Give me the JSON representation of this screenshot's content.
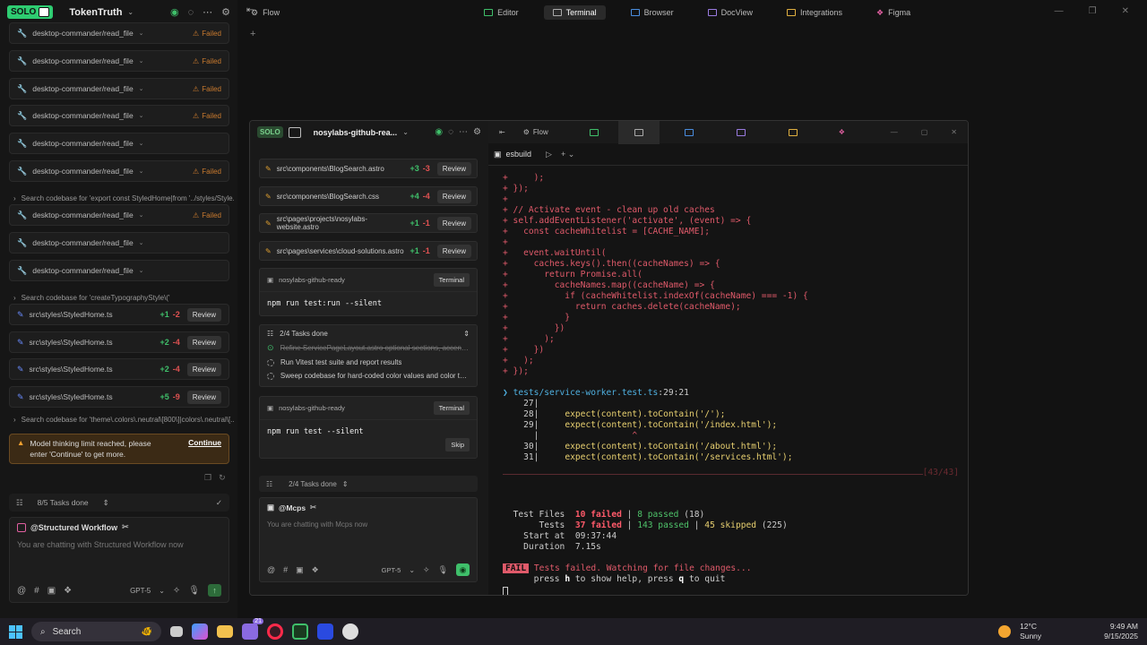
{
  "app": {
    "logo": "SOLO",
    "project": "TokenTruth"
  },
  "left": {
    "items": [
      {
        "kind": "file",
        "label": "desktop-commander/read_file",
        "status": "Failed"
      },
      {
        "kind": "file",
        "label": "desktop-commander/read_file",
        "status": "Failed"
      },
      {
        "kind": "file",
        "label": "desktop-commander/read_file",
        "status": "Failed"
      },
      {
        "kind": "file",
        "label": "desktop-commander/read_file",
        "status": "Failed"
      },
      {
        "kind": "file",
        "label": "desktop-commander/read_file",
        "status": ""
      },
      {
        "kind": "file",
        "label": "desktop-commander/read_file",
        "status": "Failed"
      },
      {
        "kind": "search",
        "label": "Search codebase for 'export const StyledHome|from '../styles/Style...'"
      },
      {
        "kind": "file",
        "label": "desktop-commander/read_file",
        "status": "Failed"
      },
      {
        "kind": "file",
        "label": "desktop-commander/read_file",
        "status": ""
      },
      {
        "kind": "file",
        "label": "desktop-commander/read_file",
        "status": ""
      },
      {
        "kind": "search",
        "label": "Search codebase for 'createTypographyStyle\\('"
      },
      {
        "kind": "diff",
        "label": "src\\styles\\StyledHome.ts",
        "plus": "+1",
        "minus": "-2",
        "btn": "Review"
      },
      {
        "kind": "diff",
        "label": "src\\styles\\StyledHome.ts",
        "plus": "+2",
        "minus": "-4",
        "btn": "Review"
      },
      {
        "kind": "diff",
        "label": "src\\styles\\StyledHome.ts",
        "plus": "+2",
        "minus": "-4",
        "btn": "Review"
      },
      {
        "kind": "diff",
        "label": "src\\styles\\StyledHome.ts",
        "plus": "+5",
        "minus": "-9",
        "btn": "Review"
      },
      {
        "kind": "search",
        "label": "Search codebase for 'theme\\.colors\\.neutral\\[800\\]|colors\\.neutral\\[..."
      }
    ],
    "warning": {
      "text": "Model thinking limit reached, please enter 'Continue' to get more.",
      "action": "Continue"
    },
    "tasks": "8/5 Tasks done",
    "chat": {
      "agent": "@Structured Workflow",
      "placeholder": "You are chatting with Structured Workflow now",
      "model": "GPT-5"
    }
  },
  "tabs": [
    {
      "label": "Flow",
      "color": "#cccccc"
    },
    {
      "label": "Editor",
      "color": "#3fbf6a"
    },
    {
      "label": "Terminal",
      "color": "#aaaaaa",
      "active": true
    },
    {
      "label": "Browser",
      "color": "#4a8ee0"
    },
    {
      "label": "DocView",
      "color": "#9a7be0"
    },
    {
      "label": "Integrations",
      "color": "#e0b040"
    },
    {
      "label": "Figma",
      "color": "#e05fa0"
    }
  ],
  "win": {
    "logo": "SOLO",
    "project": "nosylabs-github-rea...",
    "files": [
      {
        "label": "src\\components\\BlogSearch.astro",
        "plus": "+3",
        "minus": "-3",
        "btn": "Review"
      },
      {
        "label": "src\\components\\BlogSearch.css",
        "plus": "+4",
        "minus": "-4",
        "btn": "Review"
      },
      {
        "label": "src\\pages\\projects\\nosylabs-website.astro",
        "plus": "+1",
        "minus": "-1",
        "btn": "Review"
      },
      {
        "label": "src\\pages\\services\\cloud-solutions.astro",
        "plus": "+1",
        "minus": "-1",
        "btn": "Review"
      }
    ],
    "term1": {
      "name": "nosylabs-github-ready",
      "btn": "Terminal",
      "cmd": "npm run test:run --silent"
    },
    "taskpanel": {
      "title": "2/4 Tasks done",
      "items": [
        {
          "text": "Refine ServicePageLayout.astro optional sections, accent/th...",
          "done": true
        },
        {
          "text": "Run Vitest test suite and report results",
          "done": false
        },
        {
          "text": "Sweep codebase for hard-coded color values and color tok...",
          "done": false
        }
      ]
    },
    "term2": {
      "name": "nosylabs-github-ready",
      "btn": "Terminal",
      "cmd": "npm run test --silent",
      "skip": "Skip"
    },
    "tasks": "2/4 Tasks done",
    "chat": {
      "agent": "@Mcps",
      "placeholder": "You are chatting with Mcps now",
      "model": "GPT-5"
    },
    "flow": "Flow",
    "termtab": "esbuild"
  },
  "terminal": {
    "code": [
      "+     );",
      "+ });",
      "+",
      "+ // Activate event - clean up old caches",
      "+ self.addEventListener('activate', (event) => {",
      "+   const cacheWhitelist = [CACHE_NAME];",
      "+",
      "+   event.waitUntil(",
      "+     caches.keys().then((cacheNames) => {",
      "+       return Promise.all(",
      "+         cacheNames.map((cacheName) => {",
      "+           if (cacheWhitelist.indexOf(cacheName) === -1) {",
      "+             return caches.delete(cacheName);",
      "+           }",
      "+         })",
      "+       );",
      "+     })",
      "+   );",
      "+ });"
    ],
    "loc_file": "tests/service-worker.test.ts",
    "loc_pos": ":29:21",
    "lines": [
      {
        "n": "27",
        "text": ""
      },
      {
        "n": "28",
        "text": "expect(content).toContain('/');"
      },
      {
        "n": "29",
        "text": "expect(content).toContain('/index.html');"
      },
      {
        "n": "",
        "text": ""
      },
      {
        "n": "30",
        "text": "expect(content).toContain('/about.html');"
      },
      {
        "n": "31",
        "text": "expect(content).toContain('/services.html');"
      }
    ],
    "caret": "^",
    "counter": "[43/43]",
    "summary": {
      "files_label": "Test Files",
      "files_failed": "10 failed",
      "files_passed": "8 passed",
      "files_total": "(18)",
      "tests_label": "Tests",
      "tests_failed": "37 failed",
      "tests_passed": "143 passed",
      "tests_skipped": "45 skipped",
      "tests_total": "(225)",
      "start_label": "Start at",
      "start": "09:37:44",
      "dur_label": "Duration",
      "dur": "7.15s"
    },
    "fail_badge": "FAIL",
    "fail_msg": "Tests failed. Watching for file changes...",
    "help_press1": "press",
    "help_h": "h",
    "help_mid": "to show help, press",
    "help_q": "q",
    "help_end": "to quit"
  },
  "taskbar": {
    "search": "Search",
    "temp": "12°C",
    "weather": "Sunny",
    "time": "9:49 AM",
    "date": "9/15/2025",
    "badge": "21"
  }
}
